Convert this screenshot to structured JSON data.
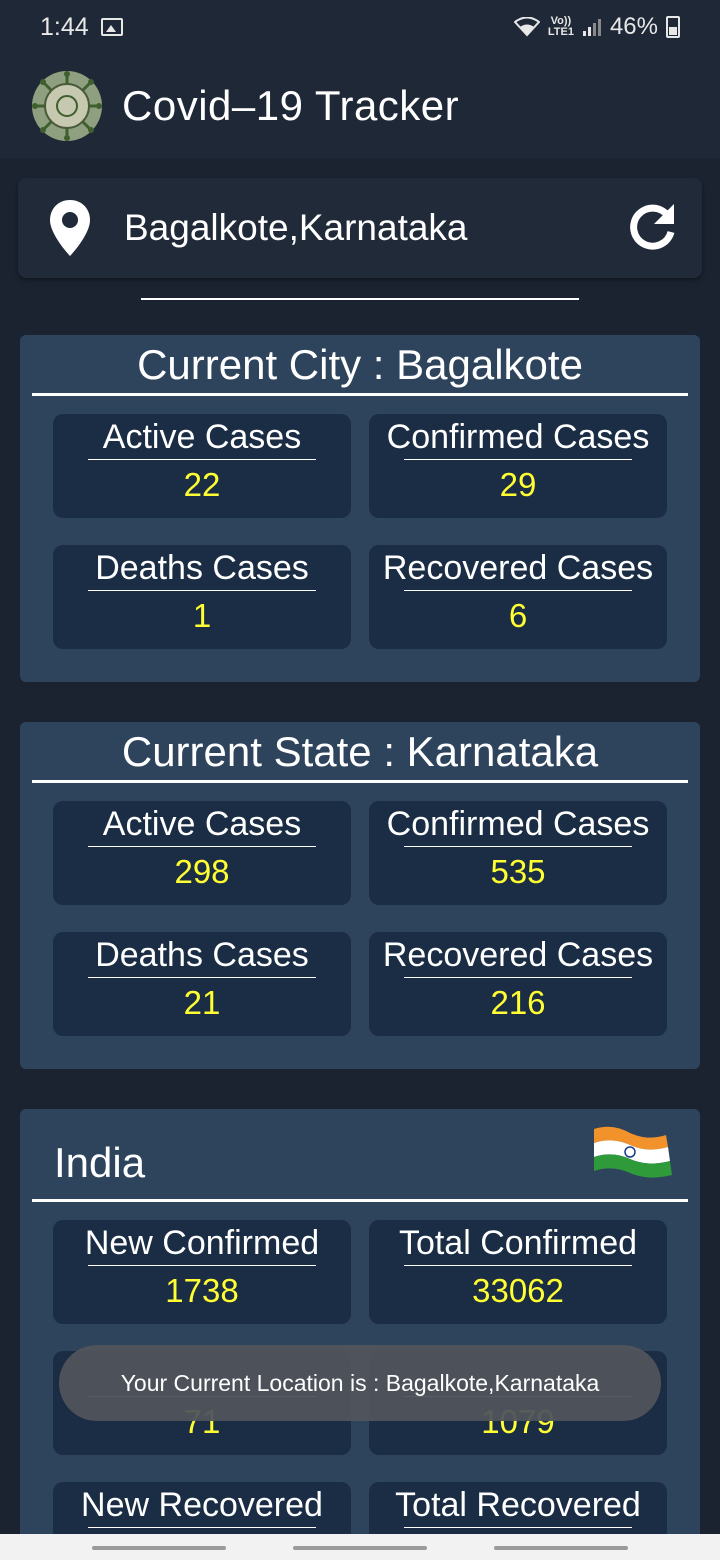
{
  "status": {
    "time": "1:44",
    "lte": "LTE1",
    "volte": "Vo))",
    "battery": "46%"
  },
  "app": {
    "title": "Covid–19 Tracker"
  },
  "location": {
    "text": "Bagalkote,Karnataka"
  },
  "city": {
    "title": "Current City : Bagalkote",
    "active_label": "Active Cases",
    "active_value": "22",
    "confirmed_label": "Confirmed Cases",
    "confirmed_value": "29",
    "deaths_label": "Deaths Cases",
    "deaths_value": "1",
    "recovered_label": "Recovered Cases",
    "recovered_value": "6"
  },
  "state": {
    "title": "Current State : Karnataka",
    "active_label": "Active Cases",
    "active_value": "298",
    "confirmed_label": "Confirmed Cases",
    "confirmed_value": "535",
    "deaths_label": "Deaths Cases",
    "deaths_value": "21",
    "recovered_label": "Recovered Cases",
    "recovered_value": "216"
  },
  "india": {
    "title": "India",
    "new_confirmed_label": "New Confirmed",
    "new_confirmed_value": "1738",
    "total_confirmed_label": "Total Confirmed",
    "total_confirmed_value": "33062",
    "new_deaths_value": "71",
    "total_deaths_value": "1079",
    "new_recovered_label": "New Recovered",
    "total_recovered_label": "Total Recovered"
  },
  "toast": {
    "text": "Your Current Location is : Bagalkote,Karnataka"
  },
  "colors": {
    "background": "#1f2836",
    "section": "#2e435c",
    "card": "#1a2d44",
    "value": "#ffff33"
  }
}
